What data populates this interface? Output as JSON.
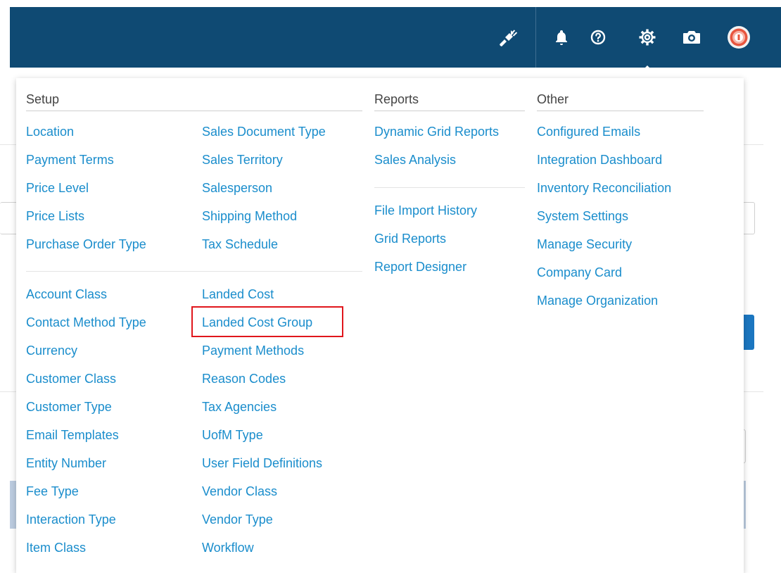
{
  "header": {
    "icons": [
      {
        "name": "plug-icon"
      },
      {
        "name": "bell-icon"
      },
      {
        "name": "help-icon"
      },
      {
        "name": "gear-icon"
      },
      {
        "name": "camera-icon"
      },
      {
        "name": "avatar"
      }
    ]
  },
  "menu": {
    "setup": {
      "title": "Setup",
      "group1_col1": [
        "Location",
        "Payment Terms",
        "Price Level",
        "Price Lists",
        "Purchase Order Type"
      ],
      "group1_col2": [
        "Sales Document Type",
        "Sales Territory",
        "Salesperson",
        "Shipping Method",
        "Tax Schedule"
      ],
      "group2_col1": [
        "Account Class",
        "Contact Method Type",
        "Currency",
        "Customer Class",
        "Customer Type",
        "Email Templates",
        "Entity Number",
        "Fee Type",
        "Interaction Type",
        "Item Class"
      ],
      "group2_col2": [
        "Landed Cost",
        "Landed Cost Group",
        "Payment Methods",
        "Reason Codes",
        "Tax Agencies",
        "UofM Type",
        "User Field Definitions",
        "Vendor Class",
        "Vendor Type",
        "Workflow"
      ]
    },
    "reports": {
      "title": "Reports",
      "group1": [
        "Dynamic Grid Reports",
        "Sales Analysis"
      ],
      "group2": [
        "File Import History",
        "Grid Reports",
        "Report Designer"
      ]
    },
    "other": {
      "title": "Other",
      "items": [
        "Configured Emails",
        "Integration Dashboard",
        "Inventory Reconciliation",
        "System Settings",
        "Manage Security",
        "Company Card",
        "Manage Organization"
      ]
    },
    "highlighted_item": "Landed Cost Group"
  },
  "colors": {
    "header_bg": "#0f4a73",
    "link": "#1a8dcc",
    "highlight_border": "#e0161c"
  }
}
